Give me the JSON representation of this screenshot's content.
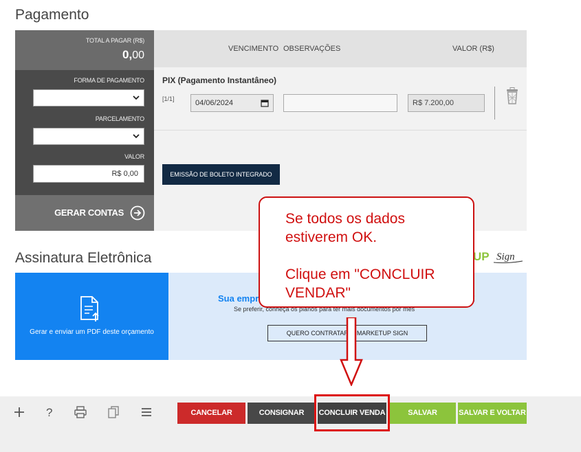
{
  "payment": {
    "title": "Pagamento",
    "total_label": "TOTAL A PAGAR (R$)",
    "total_int": "0,",
    "total_dec": "00",
    "forma_label": "FORMA DE PAGAMENTO",
    "forma_value": "",
    "parcelamento_label": "PARCELAMENTO",
    "parcelamento_value": "",
    "valor_label": "VALOR",
    "valor_value": "R$ 0,00",
    "gerar_label": "GERAR CONTAS",
    "columns": [
      "VENCIMENTO",
      "OBSERVAÇÕES",
      "VALOR (R$)"
    ],
    "entry": {
      "method": "PIX (Pagamento Instantâneo)",
      "installment": "[1/1]",
      "due_date": "04/06/2024",
      "observations": "",
      "value": "R$ 7.200,00"
    },
    "boleto_button": "EMISSÃO DE BOLETO INTEGRADO"
  },
  "signature": {
    "title": "Assinatura Eletrônica",
    "logo_text_bold": "UP",
    "logo_text_script": "Sign",
    "pdf_text": "Gerar e enviar um PDF deste orçamento",
    "headline_start": "Sua empr",
    "headline_end": "!",
    "subtext": "Se preferir, conheça os planos para ter mais documentos por mês",
    "contract_button": "QUERO CONTRATAR O MARKETUP SIGN"
  },
  "callout": {
    "text": "Se todos os dados\nestiverem OK.\n\nClique em \"CONCLUIR\nVENDAR\""
  },
  "footer": {
    "icons": [
      "plus-icon",
      "help-icon",
      "printer-icon",
      "copy-icon",
      "menu-icon"
    ],
    "buttons": {
      "cancel": "CANCELAR",
      "consignar": "CONSIGNAR",
      "concluir": "CONCLUIR VENDA",
      "salvar": "SALVAR",
      "salvar_voltar": "SALVAR E VOLTAR"
    }
  },
  "colors": {
    "dark_panel": "#4a4a4a",
    "accent_blue": "#1383f1",
    "cancel_red": "#cc2a2a",
    "save_green": "#8cc43c",
    "callout_red": "#d01010",
    "boleto_navy": "#122a44"
  }
}
